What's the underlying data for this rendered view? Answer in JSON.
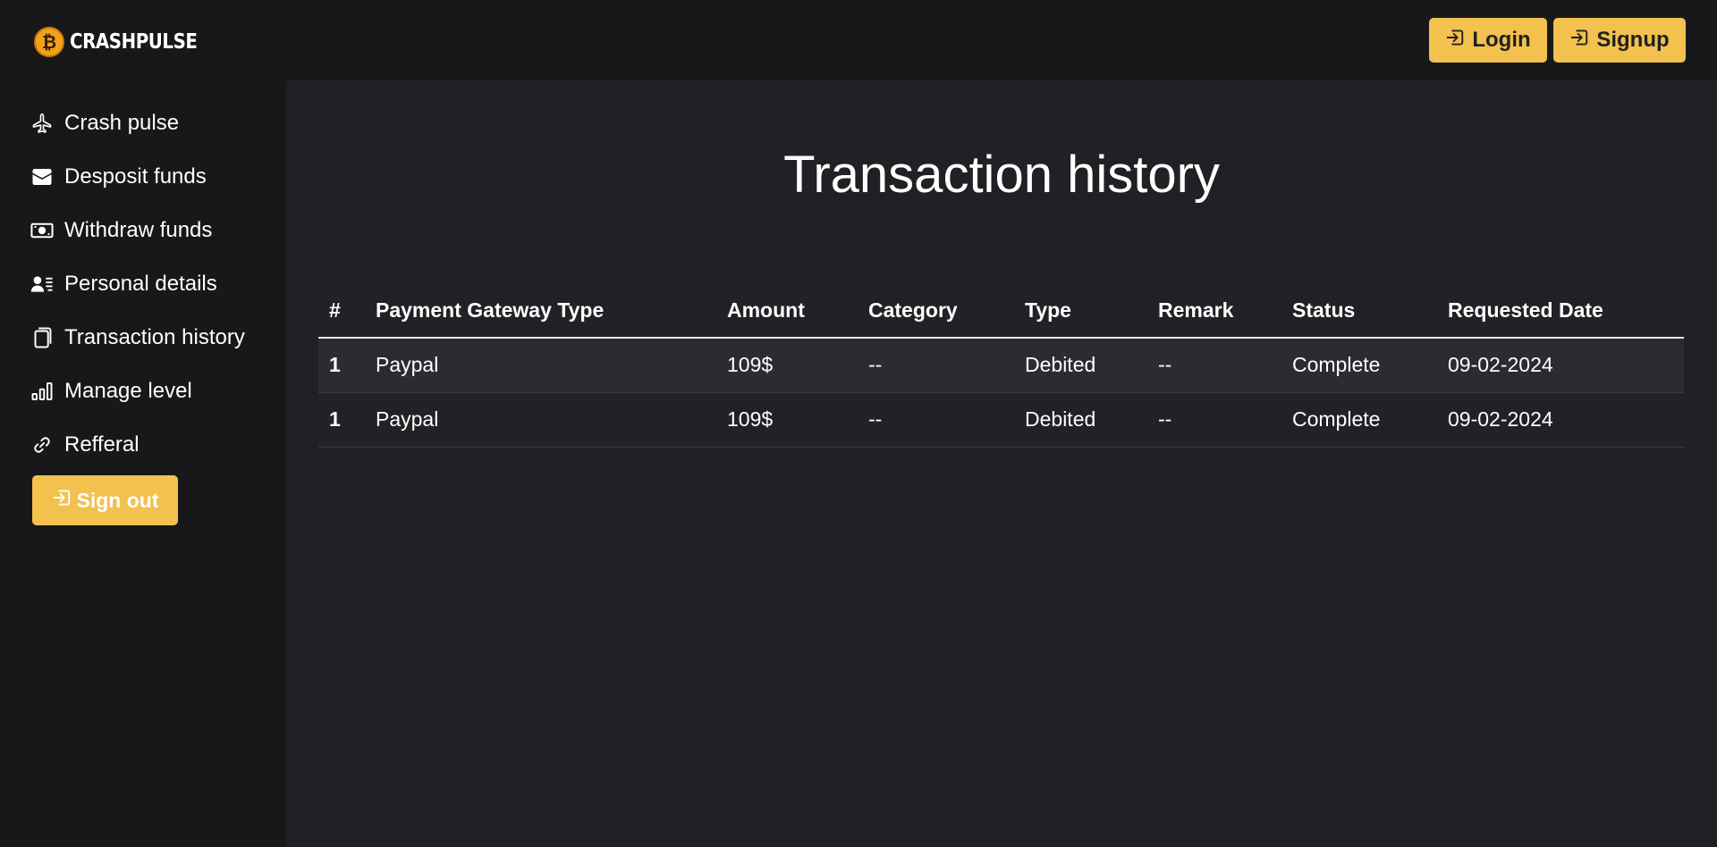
{
  "brand": {
    "name": "CRASHPULSE",
    "icon": "bitcoin-icon",
    "color": "#f0a21c"
  },
  "header": {
    "login_label": "Login",
    "signup_label": "Signup",
    "button_icon": "sign-in-icon"
  },
  "sidebar": {
    "items": [
      {
        "label": "Crash pulse",
        "icon": "airplane-icon"
      },
      {
        "label": "Desposit funds",
        "icon": "wallet-icon"
      },
      {
        "label": "Withdraw funds",
        "icon": "cash-icon"
      },
      {
        "label": "Personal details",
        "icon": "person-lines-icon"
      },
      {
        "label": "Transaction history",
        "icon": "copy-icon"
      },
      {
        "label": "Manage level",
        "icon": "bar-chart-icon"
      },
      {
        "label": "Refferal",
        "icon": "link-icon"
      }
    ],
    "signout_label": "Sign out"
  },
  "main": {
    "title": "Transaction history",
    "table": {
      "headers": [
        "#",
        "Payment Gateway Type",
        "Amount",
        "Category",
        "Type",
        "Remark",
        "Status",
        "Requested Date"
      ],
      "rows": [
        [
          "1",
          "Paypal",
          "109$",
          "--",
          "Debited",
          "--",
          "Complete",
          "09-02-2024"
        ],
        [
          "1",
          "Paypal",
          "109$",
          "--",
          "Debited",
          "--",
          "Complete",
          "09-02-2024"
        ]
      ]
    }
  },
  "colors": {
    "accent": "#f2c14e",
    "sidebar_bg": "#18181a",
    "main_bg": "#202124",
    "row_striped": "#2b2c31"
  }
}
